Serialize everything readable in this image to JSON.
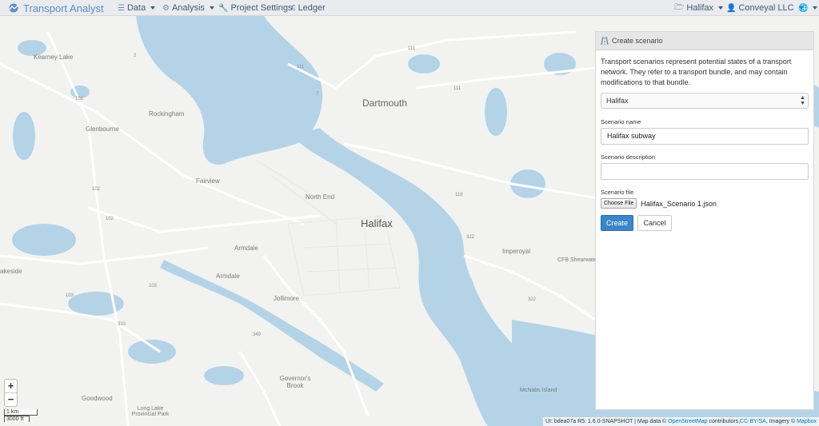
{
  "navbar": {
    "brand": "Transport Analyst",
    "items": [
      {
        "label": "Data",
        "icon": "list-icon"
      },
      {
        "label": "Analysis",
        "icon": "gear-icon"
      },
      {
        "label": "Project Settings",
        "icon": "wrench-icon"
      },
      {
        "label": "Ledger",
        "icon": "ledger-icon"
      }
    ],
    "right": [
      {
        "label": "Halifax",
        "icon": "folder-icon"
      },
      {
        "label": "Conveyal LLC",
        "icon": "user-icon"
      },
      {
        "label": "",
        "icon": "globe-icon"
      }
    ]
  },
  "map": {
    "places": [
      {
        "name": "Kearney Lake"
      },
      {
        "name": "Rockingham"
      },
      {
        "name": "Glenbourne"
      },
      {
        "name": "Fairview"
      },
      {
        "name": "Armdale"
      },
      {
        "name": "Armdale"
      },
      {
        "name": "Jollimore"
      },
      {
        "name": "Governor's Brook"
      },
      {
        "name": "Goodwood"
      },
      {
        "name": "Long Lake Provincial Park"
      },
      {
        "name": "North End"
      },
      {
        "name": "Imperoyal"
      },
      {
        "name": "CFB Shearwater"
      },
      {
        "name": "McNabs Island"
      },
      {
        "name": "akeside"
      }
    ],
    "cities": {
      "dartmouth": "Dartmouth",
      "halifax": "Halifax"
    },
    "road_labels": [
      "102",
      "102",
      "102",
      "103",
      "103",
      "333",
      "349",
      "111",
      "111",
      "118",
      "111",
      "7",
      "322",
      "322",
      "2"
    ],
    "zoom_in": "+",
    "zoom_out": "−",
    "scale": {
      "km": "1 km",
      "ft": "3000 ft"
    },
    "attribution": {
      "prefix": "UI: bdea07a R5: 1.6.0-SNAPSHOT | Map data ©",
      "osm": "OpenStreetMap",
      "mid": "contributors,",
      "license": "CC-BY-SA",
      "imagery": ", Imagery ©",
      "mapbox": "Mapbox"
    }
  },
  "panel": {
    "title": "Create scenario",
    "description": "Transport scenarios represent potential states of a transport network. They refer to a transport bundle, and may contain modifications to that bundle.",
    "bundle_select": "Halifax",
    "name_label": "Scenario name",
    "name_value": "Halifax subway",
    "description_label": "Scenario description",
    "description_value": "",
    "file_label": "Scenario file",
    "file_button": "Choose File",
    "file_name": "Halifax_Scenario 1.json",
    "create_button": "Create",
    "cancel_button": "Cancel"
  },
  "colors": {
    "water": "#b5d3e7",
    "land": "#f2f2f0",
    "road": "#ffffff",
    "accent": "#3a86c8"
  }
}
